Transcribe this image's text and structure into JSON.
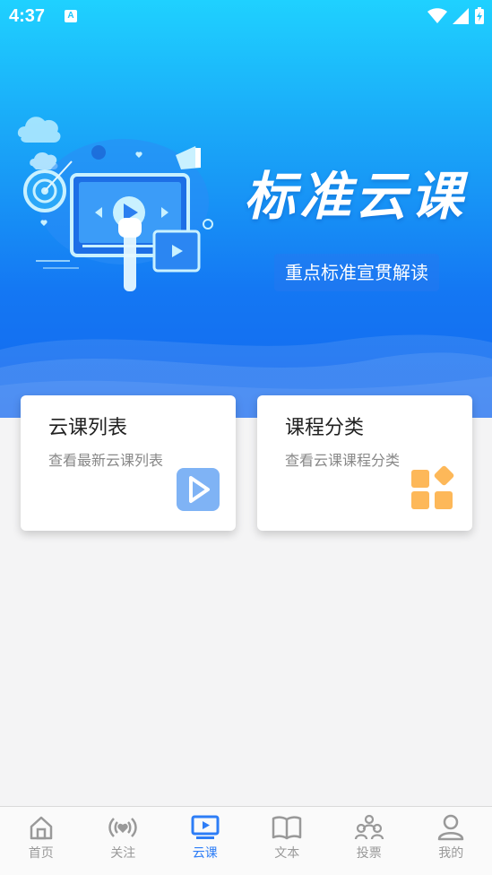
{
  "status_bar": {
    "time": "4:37",
    "notification_icon": "A"
  },
  "hero": {
    "title": "标准云课",
    "subtitle": "重点标准宣贯解读"
  },
  "cards": [
    {
      "title": "云课列表",
      "description": "查看最新云课列表",
      "icon": "play-icon",
      "icon_color": "#7fb3f5"
    },
    {
      "title": "课程分类",
      "description": "查看云课课程分类",
      "icon": "category-grid-icon",
      "icon_color": "#fdb859"
    }
  ],
  "bottom_nav": {
    "active": "云课",
    "items": [
      {
        "label": "首页",
        "icon": "home-icon"
      },
      {
        "label": "关注",
        "icon": "broadcast-heart-icon"
      },
      {
        "label": "云课",
        "icon": "tv-play-icon"
      },
      {
        "label": "文本",
        "icon": "book-icon"
      },
      {
        "label": "投票",
        "icon": "vote-people-icon"
      },
      {
        "label": "我的",
        "icon": "user-icon"
      }
    ]
  },
  "colors": {
    "accent": "#2d7df6",
    "hero_top": "#1fd1ff",
    "hero_bottom": "#1568ef",
    "inactive": "#999999"
  }
}
